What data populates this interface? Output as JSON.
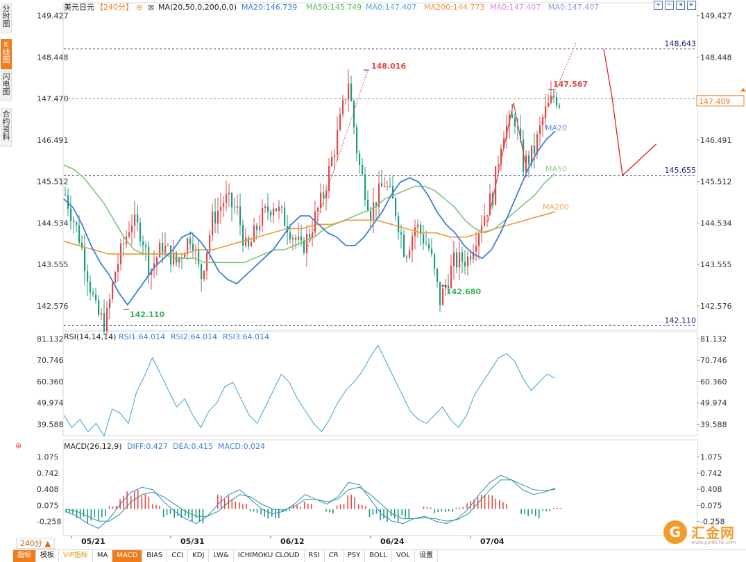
{
  "sidebar": {
    "tabs": [
      {
        "label": "分时图",
        "active": false
      },
      {
        "label": "K线图",
        "active": true
      },
      {
        "label": "闪电图",
        "active": false
      },
      {
        "label": "合约资料",
        "active": false
      }
    ]
  },
  "header": {
    "symbol": "美元日元",
    "period": "【240分】",
    "ma_label": "MA(20,50,0,200,0,0)",
    "ma_values": [
      {
        "label": "MA20:146.739",
        "color": "#3a7fd9"
      },
      {
        "label": "MA50:145.749",
        "color": "#5cb85c"
      },
      {
        "label": "MA0:147.407",
        "color": "#52a8d8"
      },
      {
        "label": "MA200:144.773",
        "color": "#f0953a"
      },
      {
        "label": "MA0:147.407",
        "color": "#d88ad0"
      },
      {
        "label": "MA0:147.407",
        "color": "#8a9be0"
      }
    ]
  },
  "rsi_header": {
    "label": "RSI(14,14,14)",
    "values": [
      {
        "label": "RSI1:64.014",
        "color": "#3a7fd9"
      },
      {
        "label": "RSI2:64.014",
        "color": "#3a7fd9"
      },
      {
        "label": "RSI3:64.014",
        "color": "#3a7fd9"
      }
    ]
  },
  "macd_header": {
    "label": "MACD(26,12,9)",
    "values": [
      {
        "label": "DIFF:0.427",
        "color": "#3a7fd9"
      },
      {
        "label": "DEA:0.415",
        "color": "#3a7fd9"
      },
      {
        "label": "MACD:0.024",
        "color": "#3a7fd9"
      }
    ]
  },
  "bottom_bar": {
    "period_button": "240分 ▲",
    "tabs": [
      {
        "label": "指标",
        "active": true
      },
      {
        "label": "模板",
        "active": false
      },
      {
        "label": "VIP指标",
        "vip": true
      },
      {
        "label": "MA"
      },
      {
        "label": "MACD",
        "active": true
      },
      {
        "label": "BIAS"
      },
      {
        "label": "CCI"
      },
      {
        "label": "KDJ"
      },
      {
        "label": "LW&"
      },
      {
        "label": "ICHIMOKU CLOUD"
      },
      {
        "label": "RSI"
      },
      {
        "label": "CR"
      },
      {
        "label": "PSY"
      },
      {
        "label": "BOLL"
      },
      {
        "label": "VOL"
      },
      {
        "label": "设置"
      }
    ]
  },
  "watermark": {
    "name": "汇金网",
    "site": "www.gold678.com",
    "logo_glyph": "G"
  },
  "colors": {
    "up": "#e04848",
    "down": "#1e9a7e",
    "ma20": "#3a7fd9",
    "ma50": "#7cc47a",
    "ma200": "#f0953a",
    "rsi": "#3a9fd8",
    "dashed": "#1a237e",
    "accent": "#f07d1b"
  },
  "chart_data": [
    {
      "type": "candlestick",
      "title": "美元日元 240分",
      "x_tick_labels": [
        "05/21",
        "05/31",
        "06/12",
        "06/24",
        "07/04"
      ],
      "ylim": [
        142.0,
        149.7
      ],
      "y_tick_labels": [
        "149.427",
        "148.448",
        "147.470",
        "146.491",
        "145.512",
        "144.534",
        "143.555",
        "142.576"
      ],
      "y_ticks": [
        149.427,
        148.448,
        147.47,
        146.491,
        145.512,
        144.534,
        143.555,
        142.576
      ],
      "horizontal_levels": [
        {
          "value": 148.643,
          "label": "148.643",
          "style": "dashed"
        },
        {
          "value": 147.47,
          "label": "",
          "style": "dashed-green"
        },
        {
          "value": 145.655,
          "label": "145.655",
          "style": "dashed"
        },
        {
          "value": 142.11,
          "label": "142.110",
          "style": "dashed"
        }
      ],
      "current_price": {
        "value": 147.409,
        "label": "147.409"
      },
      "annotations": [
        {
          "label": "148.016",
          "value": 148.016,
          "color": "#e04848"
        },
        {
          "label": "147.567",
          "value": 147.567,
          "color": "#e04848"
        },
        {
          "label": "142.680",
          "value": 142.68,
          "color": "#3cae5a"
        },
        {
          "label": "142.110",
          "value": 142.11,
          "color": "#3cae5a"
        }
      ],
      "ma_end_labels": [
        {
          "label": "MA20",
          "color": "#3a7fd9"
        },
        {
          "label": "MA50",
          "color": "#7cc47a"
        },
        {
          "label": "MA200",
          "color": "#f0953a"
        }
      ],
      "ma20": [
        145.1,
        144.9,
        144.5,
        144.0,
        143.6,
        143.3,
        142.9,
        142.6,
        142.9,
        143.2,
        143.5,
        143.7,
        143.9,
        144.2,
        144.3,
        144.1,
        143.8,
        143.4,
        143.2,
        143.1,
        143.3,
        143.5,
        143.7,
        143.9,
        144.2,
        144.5,
        144.7,
        144.7,
        144.5,
        144.3,
        144.2,
        144.0,
        144.0,
        144.2,
        144.5,
        144.8,
        145.2,
        145.5,
        145.6,
        145.5,
        145.2,
        144.8,
        144.5,
        144.3,
        144.0,
        143.8,
        143.7,
        143.9,
        144.3,
        144.8,
        145.3,
        145.8,
        146.2,
        146.5,
        146.7
      ],
      "ma50": [
        145.9,
        145.8,
        145.6,
        145.3,
        145.0,
        144.6,
        144.2,
        143.9,
        143.8,
        143.8,
        143.8,
        143.7,
        143.7,
        143.7,
        143.6,
        143.6,
        143.6,
        143.6,
        143.6,
        143.7,
        143.8,
        143.9,
        143.9,
        144.0,
        144.1,
        144.2,
        144.4,
        144.5,
        144.6,
        144.7,
        144.8,
        144.9,
        145.1,
        145.2,
        145.3,
        145.4,
        145.4,
        145.3,
        145.1,
        144.9,
        144.6,
        144.4,
        144.3,
        144.4,
        144.6,
        144.8,
        145.0,
        145.2,
        145.5,
        145.7
      ],
      "ma200": [
        144.1,
        144.0,
        143.9,
        143.8,
        143.8,
        143.8,
        143.8,
        143.8,
        143.8,
        143.9,
        143.9,
        144.0,
        144.1,
        144.2,
        144.3,
        144.4,
        144.4,
        144.5,
        144.5,
        144.6,
        144.6,
        144.6,
        144.5,
        144.4,
        144.3,
        144.3,
        144.2,
        144.2,
        144.3,
        144.4,
        144.5,
        144.6,
        144.7,
        144.8
      ],
      "forecast_path": [
        148.643,
        147.5,
        145.655,
        146.4
      ]
    },
    {
      "type": "line",
      "title": "RSI(14,14,14)",
      "y_tick_labels": [
        "81.132",
        "70.746",
        "60.360",
        "49.974",
        "39.588"
      ],
      "y_ticks": [
        81.132,
        70.746,
        60.36,
        49.974,
        39.588
      ],
      "ylim": [
        34.0,
        84.0
      ],
      "series": [
        {
          "name": "RSI1",
          "values": [
            44,
            38,
            42,
            36,
            40,
            34,
            47,
            45,
            40,
            55,
            63,
            72,
            64,
            56,
            48,
            52,
            44,
            38,
            46,
            50,
            58,
            60,
            52,
            44,
            40,
            48,
            56,
            64,
            60,
            52,
            46,
            40,
            36,
            42,
            50,
            56,
            60,
            65,
            72,
            78,
            70,
            62,
            54,
            46,
            42,
            40,
            44,
            48,
            42,
            38,
            44,
            54,
            60,
            66,
            72,
            74,
            70,
            62,
            56,
            60,
            64,
            62
          ]
        }
      ]
    },
    {
      "type": "bar",
      "title": "MACD(26,12,9)",
      "y_tick_labels": [
        "1.075",
        "0.742",
        "0.408",
        "0.075",
        "-0.258"
      ],
      "y_ticks": [
        1.075,
        0.742,
        0.408,
        0.075,
        -0.258
      ],
      "ylim": [
        -0.55,
        1.2
      ],
      "series": [
        {
          "name": "DIFF",
          "values": [
            -0.05,
            -0.15,
            -0.3,
            -0.4,
            -0.2,
            0.1,
            0.35,
            0.45,
            0.4,
            0.15,
            -0.05,
            -0.2,
            -0.3,
            -0.15,
            0.1,
            0.3,
            0.4,
            0.2,
            0.0,
            -0.1,
            -0.05,
            0.1,
            0.3,
            0.2,
            0.1,
            0.25,
            0.55,
            0.5,
            0.2,
            -0.1,
            -0.25,
            -0.3,
            -0.2,
            -0.15,
            -0.25,
            -0.3,
            -0.2,
            0.0,
            0.3,
            0.55,
            0.7,
            0.6,
            0.4,
            0.3,
            0.35,
            0.43
          ]
        },
        {
          "name": "DEA",
          "values": [
            0.0,
            -0.05,
            -0.15,
            -0.25,
            -0.25,
            -0.1,
            0.15,
            0.3,
            0.35,
            0.25,
            0.1,
            -0.05,
            -0.15,
            -0.15,
            -0.05,
            0.15,
            0.3,
            0.25,
            0.1,
            0.0,
            -0.02,
            0.05,
            0.2,
            0.2,
            0.15,
            0.2,
            0.4,
            0.45,
            0.3,
            0.1,
            -0.1,
            -0.2,
            -0.2,
            -0.18,
            -0.2,
            -0.25,
            -0.22,
            -0.1,
            0.15,
            0.4,
            0.6,
            0.6,
            0.5,
            0.4,
            0.38,
            0.41
          ]
        },
        {
          "name": "MACD",
          "values": [
            -0.1,
            -0.2,
            -0.3,
            -0.3,
            0.1,
            0.4,
            0.4,
            0.3,
            0.1,
            -0.2,
            -0.3,
            -0.3,
            -0.3,
            0.0,
            0.3,
            0.3,
            0.2,
            -0.1,
            -0.2,
            -0.2,
            -0.05,
            0.1,
            0.2,
            0.0,
            -0.1,
            0.1,
            0.3,
            0.1,
            -0.2,
            -0.4,
            -0.3,
            -0.2,
            0.0,
            0.05,
            -0.1,
            -0.1,
            0.05,
            0.2,
            0.3,
            0.3,
            0.2,
            0.0,
            -0.2,
            -0.2,
            -0.05,
            0.024
          ]
        }
      ]
    }
  ]
}
